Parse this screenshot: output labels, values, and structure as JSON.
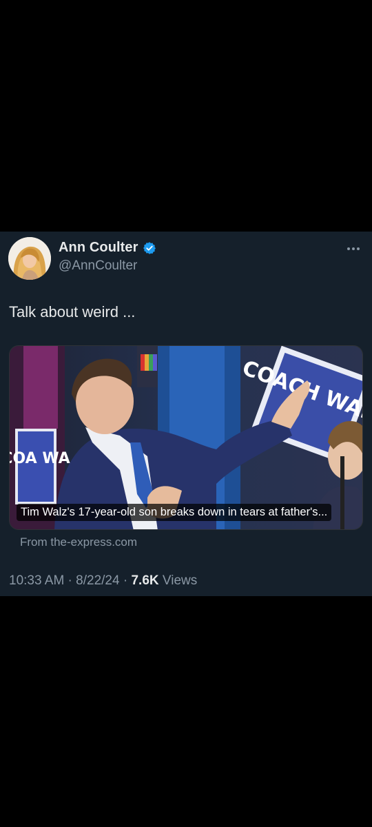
{
  "tweet": {
    "author": {
      "display_name": "Ann Coulter",
      "handle": "@AnnCoulter",
      "verified": true
    },
    "text": "Talk about weird ...",
    "card": {
      "caption": "Tim Walz's 17-year-old son breaks down in tears at father's...",
      "source": "From the-express.com",
      "sign_texts": [
        "COACH WALZ",
        "COA WA"
      ]
    },
    "meta": {
      "time": "10:33 AM",
      "separator": " · ",
      "date": "8/22/24",
      "views_count": "7.6K",
      "views_label": " Views"
    }
  },
  "colors": {
    "background": "#000000",
    "card_bg": "#15202b",
    "primary_text": "#e7e9ea",
    "secondary_text": "#8b98a5",
    "verified_blue": "#1d9bf0"
  },
  "icons": [
    "verified-badge-icon",
    "more-options-icon"
  ]
}
